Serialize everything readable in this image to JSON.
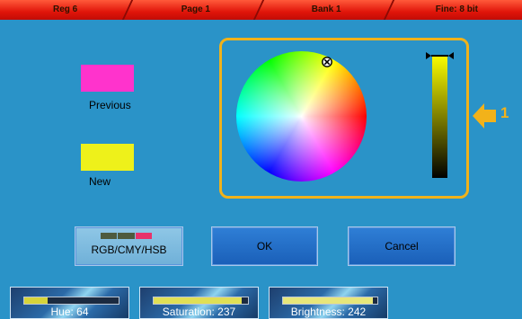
{
  "status_bar": [
    "Reg 6",
    "Page 1",
    "Bank 1",
    "Fine: 8 bit"
  ],
  "swatches": {
    "previous": {
      "label": "Previous",
      "color": "#ff33cc"
    },
    "new": {
      "label": "New",
      "color": "#eef11a"
    }
  },
  "color_picker": {
    "panel_number": "1",
    "accent_color": "#f2b21a",
    "selected_hue": 64,
    "selected_saturation": 237,
    "selected_brightness": 242
  },
  "buttons": {
    "mode": "RGB/CMY/HSB",
    "ok": "OK",
    "cancel": "Cancel"
  },
  "sliders": [
    {
      "label": "Hue: 64",
      "value_fraction": 0.25,
      "color": "#d7d43a"
    },
    {
      "label": "Saturation: 237",
      "value_fraction": 0.93,
      "color": "#e0df55"
    },
    {
      "label": "Brightness: 242",
      "value_fraction": 0.95,
      "color": "#e7e67a"
    }
  ]
}
